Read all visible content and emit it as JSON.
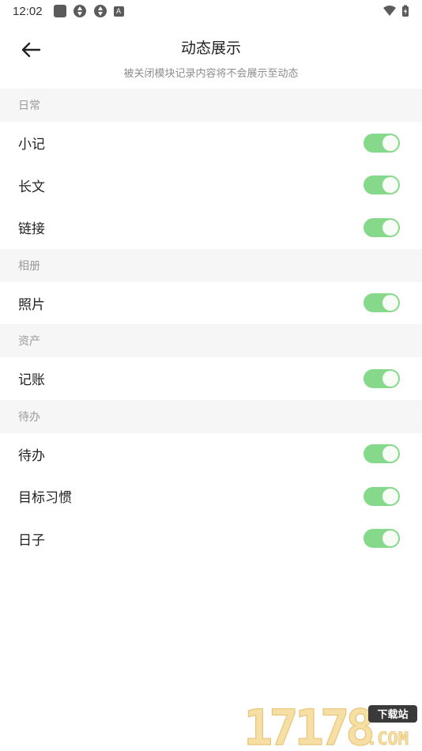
{
  "status_bar": {
    "time": "12:02",
    "badge_letter": "A"
  },
  "header": {
    "title": "动态展示",
    "subtitle": "被关闭模块记录内容将不会展示至动态"
  },
  "sections": [
    {
      "title": "日常",
      "items": [
        {
          "label": "小记",
          "enabled": true
        },
        {
          "label": "长文",
          "enabled": true
        },
        {
          "label": "链接",
          "enabled": true
        }
      ]
    },
    {
      "title": "相册",
      "items": [
        {
          "label": "照片",
          "enabled": true
        }
      ]
    },
    {
      "title": "资产",
      "items": [
        {
          "label": "记账",
          "enabled": true
        }
      ]
    },
    {
      "title": "待办",
      "items": [
        {
          "label": "待办",
          "enabled": true
        },
        {
          "label": "目标习惯",
          "enabled": true
        },
        {
          "label": "日子",
          "enabled": true
        }
      ]
    }
  ],
  "watermark": {
    "number": "17178",
    "badge": "下载站",
    "domain": ".COM"
  },
  "colors": {
    "toggle_on": "#86d98a",
    "section_bg": "#f6f6f6"
  }
}
